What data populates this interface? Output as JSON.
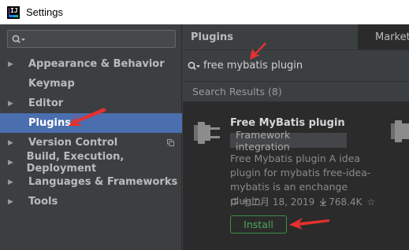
{
  "window": {
    "title": "Settings",
    "logo_text": "IJ"
  },
  "sidebar": {
    "search": {
      "value": "",
      "placeholder": ""
    },
    "items": [
      {
        "label": "Appearance & Behavior",
        "expandable": true
      },
      {
        "label": "Keymap",
        "expandable": false
      },
      {
        "label": "Editor",
        "expandable": true
      },
      {
        "label": "Plugins",
        "expandable": false,
        "selected": true
      },
      {
        "label": "Version Control",
        "expandable": true,
        "has_copy_icon": true
      },
      {
        "label": "Build, Execution, Deployment",
        "expandable": true
      },
      {
        "label": "Languages & Frameworks",
        "expandable": true
      },
      {
        "label": "Tools",
        "expandable": true
      }
    ]
  },
  "plugins": {
    "title": "Plugins",
    "tabs": [
      "Market"
    ],
    "search_query": "free mybatis plugin",
    "results_label": "Search Results (8)",
    "result": {
      "name": "Free MyBatis plugin",
      "tag": "Framework integration",
      "description": "Free Mybatis plugin A idea plugin for mybatis free-idea-mybatis is an enchange plugin.",
      "date": "十二月 18, 2019",
      "downloads": "768.4K",
      "install_label": "Install"
    }
  },
  "colors": {
    "selection": "#4b6eaf",
    "install_green": "#4fa85c",
    "annotation_red": "#e53030"
  }
}
